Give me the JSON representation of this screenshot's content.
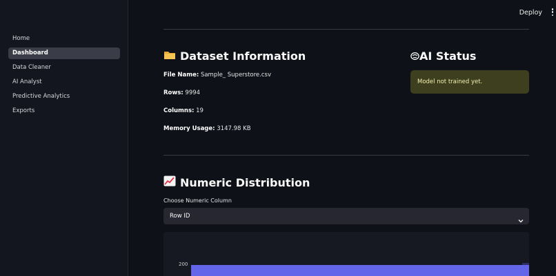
{
  "header": {
    "deploy_label": "Deploy"
  },
  "sidebar": {
    "items": [
      {
        "label": "Home"
      },
      {
        "label": "Dashboard"
      },
      {
        "label": "Data Cleaner"
      },
      {
        "label": "AI Analyst"
      },
      {
        "label": "Predictive Analytics"
      },
      {
        "label": "Exports"
      }
    ],
    "active": "Dashboard"
  },
  "dataset": {
    "title": "Dataset Information",
    "icon": "folder-icon",
    "file_name_label": "File Name:",
    "file_name": "Sample_ Superstore.csv",
    "rows_label": "Rows:",
    "rows": "9994",
    "columns_label": "Columns:",
    "columns": "19",
    "memory_label": "Memory Usage:",
    "memory": "3147.98 KB"
  },
  "ai_status": {
    "title": "AI Status",
    "icon": "brain-icon",
    "message": "Model not trained yet."
  },
  "distribution": {
    "title": "Numeric Distribution",
    "icon": "chart-increasing-icon",
    "select_label": "Choose Numeric Column",
    "selected": "Row ID",
    "y_tick": "200"
  },
  "colors": {
    "accent": "#6366e8",
    "warning_bg": "#3e3f1f",
    "warning_text": "#f4f1b0"
  }
}
